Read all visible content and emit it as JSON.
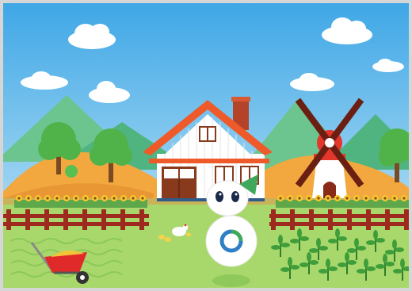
{
  "scene": {
    "name": "Farm",
    "colors": {
      "sky_top": "#3fa7e6",
      "sky_bottom": "#bfe5f8",
      "mountain": "#5bbf8a",
      "hills": "#f3b24a",
      "grass": "#a8d86b",
      "grass_dark": "#8cc85a",
      "fence": "#9e2a1f",
      "roof": "#ef5a2a",
      "house_wall": "#ffffff",
      "door": "#8a3a1c",
      "windmill_blades": "#6b1f12",
      "windmill_tower": "#ffffff",
      "sunflower": "#f7c92c",
      "wheelbarrow": "#e02a2a",
      "robot_body": "#ffffff",
      "robot_logo_blue": "#2f7fc6",
      "robot_logo_green": "#3fa85a"
    }
  },
  "icons": {
    "house": "farmhouse-icon",
    "windmill": "windmill-icon",
    "robot": "robot-mascot-icon",
    "wheelbarrow": "wheelbarrow-icon",
    "hen": "hen-icon"
  }
}
